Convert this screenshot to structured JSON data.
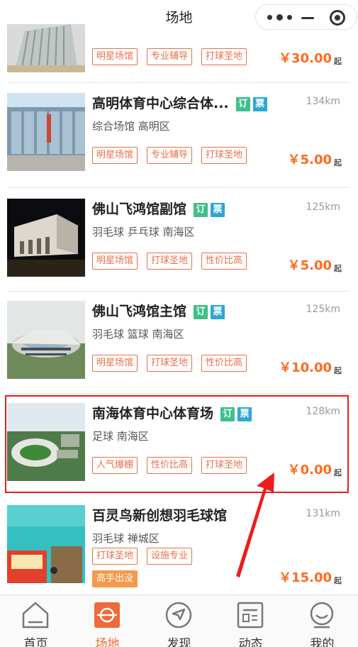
{
  "header": {
    "title": "场地"
  },
  "capsule": {
    "more_icon": "more-dots-icon",
    "minimize_icon": "minimize-icon",
    "close_icon": "target-close-icon"
  },
  "venues": [
    {
      "name": "",
      "dist": "",
      "sub": "",
      "tags": [
        "明星场馆",
        "专业辅导",
        "打球圣地"
      ],
      "price": "￥30.00",
      "from": "起"
    },
    {
      "name": "高明体育中心综合体...",
      "badges": [
        "订",
        "票"
      ],
      "dist": "134km",
      "sub": "综合场馆  高明区",
      "tags": [
        "明星场馆",
        "专业辅导",
        "打球圣地"
      ],
      "price": "￥5.00",
      "from": "起"
    },
    {
      "name": "佛山飞鸿馆副馆",
      "badges": [
        "订",
        "票"
      ],
      "dist": "125km",
      "sub": "羽毛球  乒乓球  南海区",
      "tags": [
        "明星场馆",
        "打球圣地",
        "性价比高"
      ],
      "price": "￥5.00",
      "from": "起"
    },
    {
      "name": "佛山飞鸿馆主馆",
      "badges": [
        "订",
        "票"
      ],
      "dist": "125km",
      "sub": "羽毛球  篮球  南海区",
      "tags": [
        "明星场馆",
        "打球圣地",
        "性价比高"
      ],
      "price": "￥10.00",
      "from": "起"
    },
    {
      "name": "南海体育中心体育场",
      "badges": [
        "订",
        "票"
      ],
      "dist": "128km",
      "sub": "足球  南海区",
      "tags": [
        "人气爆棚",
        "性价比高",
        "打球圣地"
      ],
      "price": "￥0.00",
      "from": "起"
    },
    {
      "name": "百灵鸟新创想羽毛球馆",
      "dist": "131km",
      "sub": "羽毛球  禅城区",
      "tags": [
        "打球圣地",
        "设施专业"
      ],
      "extra_tag": "高手出没",
      "price": "￥15.00",
      "from": "起"
    }
  ],
  "tabbar": [
    {
      "label": "首页",
      "icon": "home-icon"
    },
    {
      "label": "场地",
      "icon": "venue-icon"
    },
    {
      "label": "发现",
      "icon": "compass-icon"
    },
    {
      "label": "动态",
      "icon": "feed-icon"
    },
    {
      "label": "我的",
      "icon": "profile-icon"
    }
  ],
  "colors": {
    "accent": "#ef6a3a",
    "price": "#ff6a1d",
    "highlight": "#e02020",
    "ding": "#3fbf8a",
    "piao": "#2aa8d8"
  }
}
